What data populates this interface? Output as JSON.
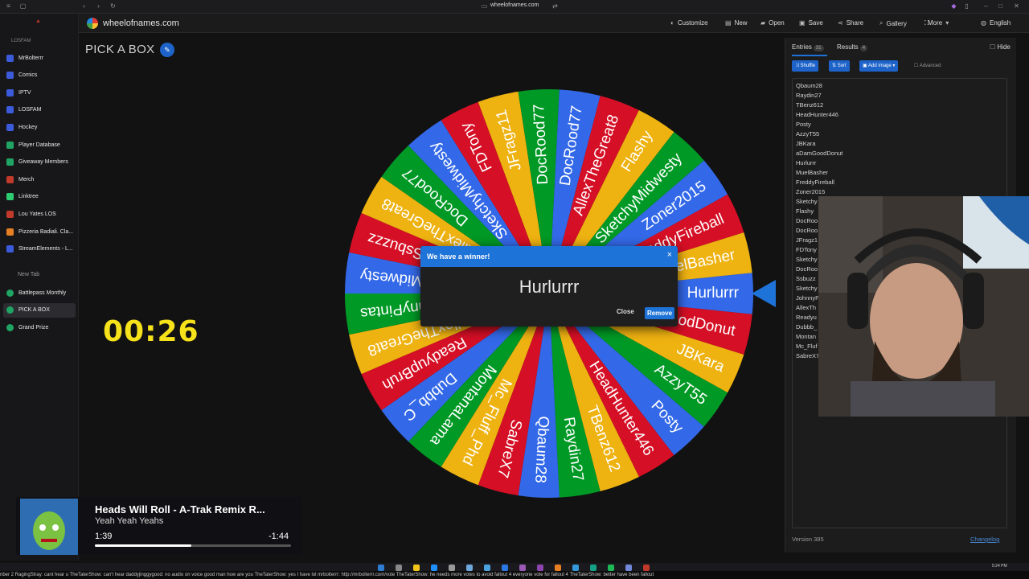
{
  "browser": {
    "url": "wheelofnames.com"
  },
  "sidebar": {
    "group_label": "LOSFAM",
    "items": [
      {
        "label": "MrBolterrr",
        "color": "#3b5bdb"
      },
      {
        "label": "Comics",
        "color": "#3b5bdb"
      },
      {
        "label": "IPTV",
        "color": "#3b5bdb"
      },
      {
        "label": "LOSFAM",
        "color": "#3b5bdb"
      },
      {
        "label": "Hockey",
        "color": "#3b5bdb"
      },
      {
        "label": "Player Database",
        "color": "#1fa463"
      },
      {
        "label": "Giveaway Members",
        "color": "#1fa463"
      },
      {
        "label": "Merch",
        "color": "#c0392b"
      },
      {
        "label": "Linktree",
        "color": "#2ecc71"
      },
      {
        "label": "Lou Yates LOS",
        "color": "#c0392b"
      },
      {
        "label": "Pizzeria Badiali. Cla...",
        "color": "#e67e22"
      },
      {
        "label": "StreamElements - L...",
        "color": "#3b5bdb"
      }
    ],
    "new_tab": "New Tab",
    "pinned": [
      {
        "label": "Battlepass Monthly",
        "color": "#1fa463"
      },
      {
        "label": "PICK A BOX",
        "color": "#1fa463"
      },
      {
        "label": "Grand Prize",
        "color": "#1fa463"
      }
    ]
  },
  "appbar": {
    "site_name": "wheelofnames.com",
    "menu": [
      {
        "label": "Customize",
        "icon": "palette-icon"
      },
      {
        "label": "New",
        "icon": "file-icon"
      },
      {
        "label": "Open",
        "icon": "folder-icon"
      },
      {
        "label": "Save",
        "icon": "save-icon"
      },
      {
        "label": "Share",
        "icon": "share-icon"
      },
      {
        "label": "Gallery",
        "icon": "search-icon"
      },
      {
        "label": "More",
        "icon": "chevron-down-icon"
      },
      {
        "label": "English",
        "icon": "globe-icon"
      }
    ]
  },
  "wheel": {
    "title": "PICK A BOX",
    "timer": "00:26",
    "segments": [
      "Hurlurrr",
      "aDamGoodDonut",
      "JBKara",
      "AzzyT55",
      "Posty",
      "HeadHunter446",
      "TBenz612",
      "Raydin27",
      "Qbaum28",
      "SabreX7",
      "Mc_Fluff_Phd",
      "MontanaLama",
      "Dubbb_C",
      "ReadyupBruh",
      "AllexTheGreat8",
      "JohnnyPintas",
      "SketchyMidwesty",
      "Ssbuzzz",
      "AllexTheGreat8",
      "DocRood77",
      "SketchyMidwesty",
      "FDTony",
      "JFragz11",
      "DocRood77",
      "DocRood77",
      "AllexTheGreat8",
      "Flashy",
      "SketchyMidwesty",
      "Zoner2015",
      "FreddyFireball",
      "MuelBasher"
    ],
    "colors": [
      "#3369e8",
      "#d50f25",
      "#eeb211",
      "#009925"
    ]
  },
  "dialog": {
    "title": "We have a winner!",
    "winner": "Hurlurrr",
    "close_label": "Close",
    "remove_label": "Remove"
  },
  "panel": {
    "tab_entries": "Entries",
    "entries_count": "31",
    "tab_results": "Results",
    "results_count": "4",
    "hide_label": "Hide",
    "shuffle_label": "Shuffle",
    "sort_label": "Sort",
    "add_image_label": "Add image",
    "advanced_label": "Advanced",
    "entries": [
      "Qbaum28",
      "Raydin27",
      "TBenz612",
      "HeadHunter446",
      "Posty",
      "AzzyT55",
      "JBKara",
      "aDamGoodDonut",
      "Hurlurrr",
      "MuelBasher",
      "FreddyFireball",
      "Zoner2015",
      "Sketchy",
      "Flashy",
      "DocRoo",
      "DocRoo",
      "JFragz1",
      "FDTony",
      "Sketchy",
      "DocRoo",
      "Ssbuzz",
      "Sketchy",
      "JohnnyP",
      "AllexTh",
      "Readyu",
      "Dubbb_",
      "Montan",
      "Mc_Fluf",
      "SabreX7"
    ],
    "version": "Version 385",
    "changelog": "Changelog"
  },
  "now_playing": {
    "title": "Heads Will Roll - A-Trak Remix R...",
    "artist": "Yeah Yeah Yeahs",
    "elapsed": "1:39",
    "remaining": "-1:44",
    "progress": 0.49
  },
  "ticker": "nber 2  RagingStray: cant hear u  TheTaterShow: can't hear  daddyjinggygood: no audio on voice good man how are you  TheTaterShow: yes I have lol  mrbolterrr: http://mrbolterrr.com/vote  TheTaterShow: he needs more votes to avoid fallout 4  everyone vote for fallout 4  TheTaterShow: better have been fallout",
  "clock": "5:24 PM"
}
